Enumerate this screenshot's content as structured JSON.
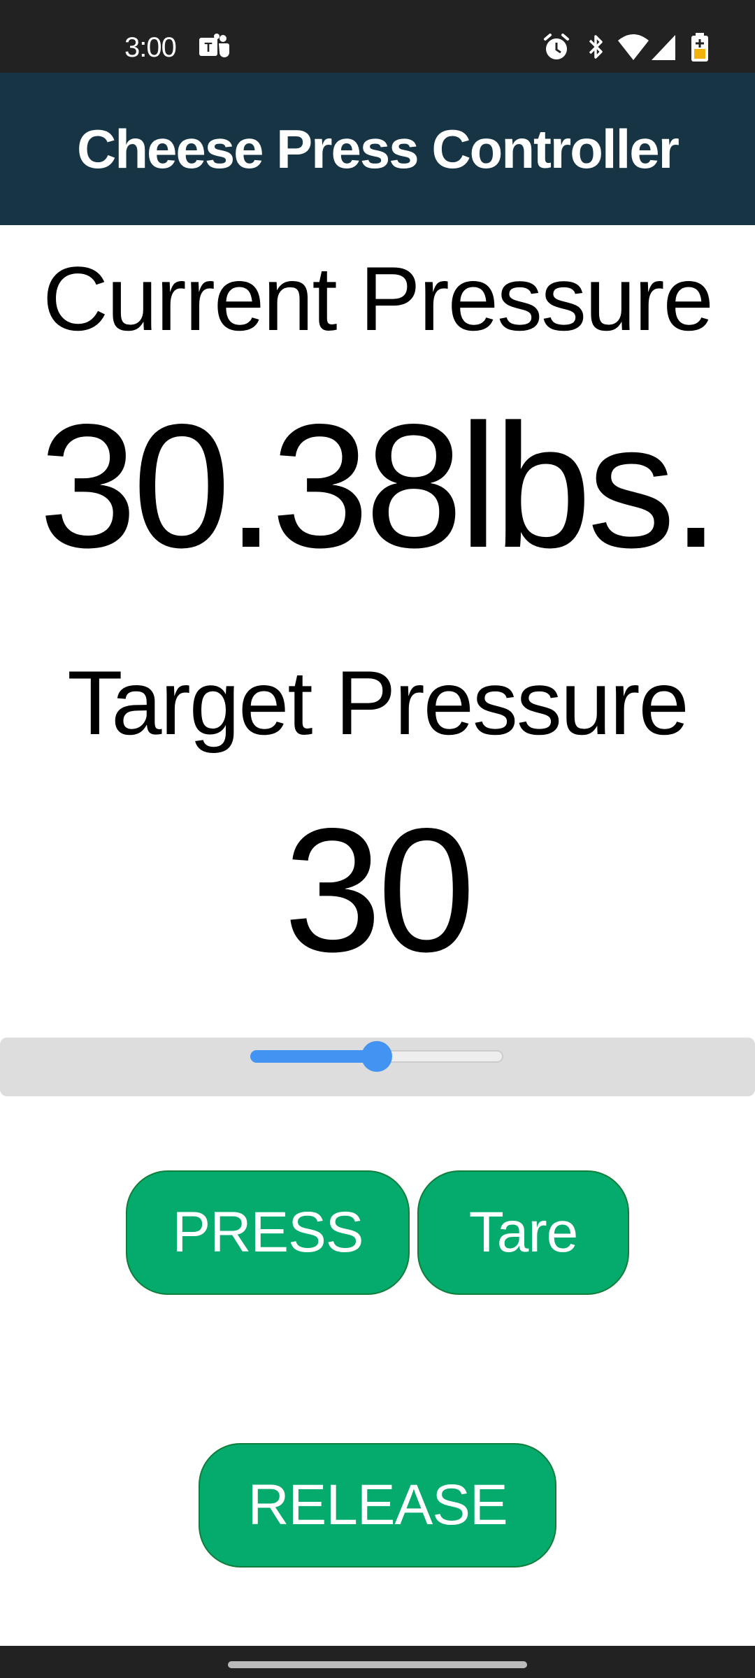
{
  "status_bar": {
    "time": "3:00",
    "icons": [
      "teams-icon",
      "alarm-icon",
      "bluetooth-icon",
      "wifi-icon",
      "signal-icon",
      "battery-icon"
    ]
  },
  "header": {
    "title": "Cheese Press Controller",
    "background_color": "#163443"
  },
  "current_pressure": {
    "label": "Current Pressure",
    "value": "30.38lbs."
  },
  "target_pressure": {
    "label": "Target Pressure",
    "value": "30",
    "slider_fraction": 0.5
  },
  "buttons": {
    "press_label": "PRESS",
    "tare_label": "Tare",
    "release_label": "RELEASE",
    "color": "#05aa6d"
  },
  "colors": {
    "slider_accent": "#4393f3"
  }
}
